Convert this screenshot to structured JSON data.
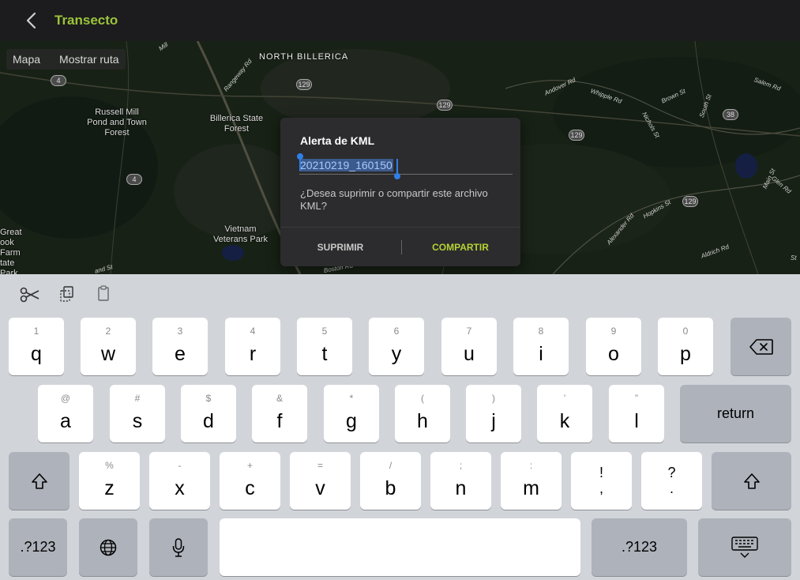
{
  "header": {
    "title": "Transecto",
    "back_icon": "chevron-left-icon"
  },
  "map": {
    "tabs": [
      "Mapa",
      "Mostrar ruta"
    ],
    "places": [
      {
        "name": "north-billerica",
        "label": "NORTH BILLERICA"
      },
      {
        "name": "russell-mill",
        "label": "Russell Mill Pond and Town Forest"
      },
      {
        "name": "billerica-state-forest",
        "label": "Billerica State Forest"
      },
      {
        "name": "vietnam-veterans-park",
        "label": "Vietnam Veterans Park"
      },
      {
        "name": "great-brook",
        "label": "Great ook Farm tate Park"
      }
    ],
    "routes": [
      "4",
      "4",
      "129",
      "129",
      "129",
      "129",
      "38"
    ],
    "streets": [
      "Mill",
      "Rangeway Rd",
      "Andover Rd",
      "Whipple Rd",
      "Salem Rd",
      "Brown St",
      "South St",
      "Nichols St",
      "Glen Rd",
      "Main St",
      "Hopkins St",
      "Alexander Rd",
      "Aldrich Rd",
      "Boston Rd",
      "St",
      "and St"
    ]
  },
  "dialog": {
    "title": "Alerta de KML",
    "input_value": "20210219_160150",
    "message": "¿Desea suprimir o compartir este archivo KML?",
    "cancel_label": "SUPRIMIR",
    "confirm_label": "COMPARTIR",
    "accent_color": "#b5d334"
  },
  "keyboard": {
    "shortcuts": [
      "scissors-icon",
      "copy-icon",
      "paste-icon"
    ],
    "row1": [
      {
        "hint": "1",
        "key": "q"
      },
      {
        "hint": "2",
        "key": "w"
      },
      {
        "hint": "3",
        "key": "e"
      },
      {
        "hint": "4",
        "key": "r"
      },
      {
        "hint": "5",
        "key": "t"
      },
      {
        "hint": "6",
        "key": "y"
      },
      {
        "hint": "7",
        "key": "u"
      },
      {
        "hint": "8",
        "key": "i"
      },
      {
        "hint": "9",
        "key": "o"
      },
      {
        "hint": "0",
        "key": "p"
      }
    ],
    "row2": [
      {
        "hint": "@",
        "key": "a"
      },
      {
        "hint": "#",
        "key": "s"
      },
      {
        "hint": "$",
        "key": "d"
      },
      {
        "hint": "&",
        "key": "f"
      },
      {
        "hint": "*",
        "key": "g"
      },
      {
        "hint": "(",
        "key": "h"
      },
      {
        "hint": ")",
        "key": "j"
      },
      {
        "hint": "’",
        "key": "k"
      },
      {
        "hint": "”",
        "key": "l"
      }
    ],
    "row3": [
      {
        "hint": "%",
        "key": "z"
      },
      {
        "hint": "-",
        "key": "x"
      },
      {
        "hint": "+",
        "key": "c"
      },
      {
        "hint": "=",
        "key": "v"
      },
      {
        "hint": "/",
        "key": "b"
      },
      {
        "hint": ";",
        "key": "n"
      },
      {
        "hint": ":",
        "key": "m"
      }
    ],
    "punct1": {
      "top": "!",
      "bottom": ","
    },
    "punct2": {
      "top": "?",
      "bottom": "."
    },
    "return_label": "return",
    "numbers_label": ".?123"
  }
}
